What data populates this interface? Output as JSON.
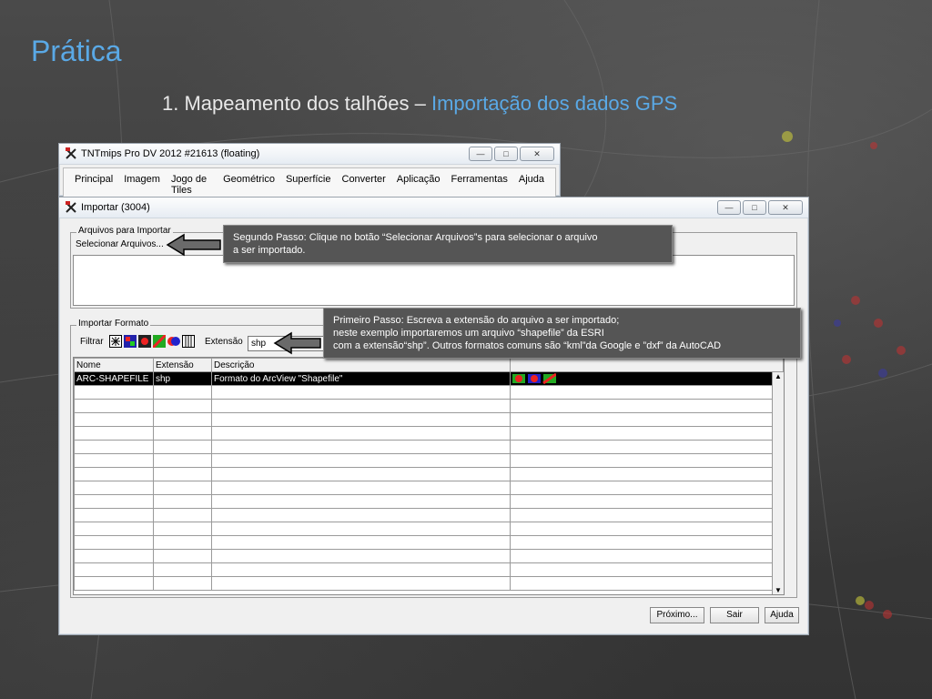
{
  "slide": {
    "title": "Prática",
    "subtitle_main": "1. Mapeamento dos talhões – ",
    "subtitle_highlight": "Importação dos dados GPS"
  },
  "main_window": {
    "title": "TNTmips Pro DV 2012  #21613 (floating)",
    "menu": [
      "Principal",
      "Imagem",
      "Jogo de Tiles",
      "Geométrico",
      "Superfície",
      "Converter",
      "Aplicação",
      "Ferramentas",
      "Ajuda"
    ]
  },
  "import_window": {
    "title": "Importar (3004)",
    "files_group_label": "Arquivos para Importar",
    "select_files_label": "Selecionar Arquivos...",
    "format_group_label": "Importar Formato",
    "filter_label": "Filtrar",
    "extension_label": "Extensão",
    "extension_value": "shp",
    "table": {
      "headers": [
        "Nome",
        "Extensão",
        "Descrição",
        ""
      ],
      "rows": [
        [
          "ARC-SHAPEFILE",
          "shp",
          "Formato do ArcView \"Shapefile\"",
          ""
        ]
      ]
    },
    "buttons": {
      "next": "Próximo...",
      "exit": "Sair",
      "help": "Ajuda"
    }
  },
  "callouts": {
    "second_step": [
      "Segundo Passo: Clique no botão “Selecionar Arquivos”s para selecionar o arquivo",
      "a ser importado."
    ],
    "first_step": [
      "Primeiro Passo: Escreva a extensão do arquivo a ser importado;",
      "neste exemplo importaremos um arquivo “shapefile”  da ESRI",
      "com a extensão“shp”. Outros formatos comuns são “kml”da Google e ”dxf” da AutoCAD"
    ]
  },
  "colors": {
    "accent": "#5aa9e6",
    "callout_bg": "#555555"
  }
}
